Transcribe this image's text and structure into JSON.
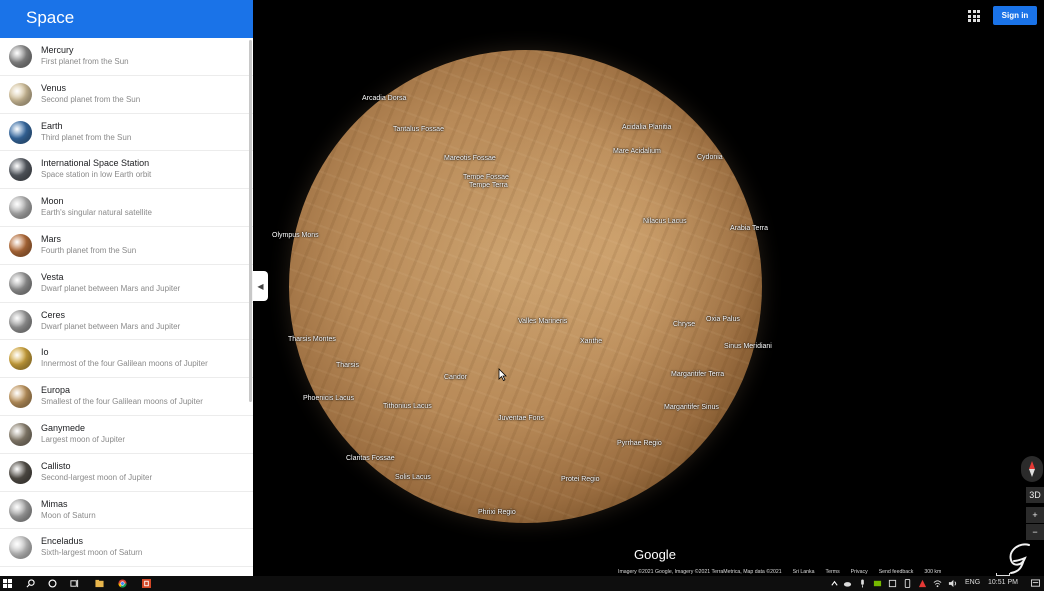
{
  "sidebar": {
    "title": "Space",
    "items": [
      {
        "name": "Mercury",
        "desc": "First planet from the Sun",
        "color": "#8d8d8d"
      },
      {
        "name": "Venus",
        "desc": "Second planet from the Sun",
        "color": "#d9c7a1"
      },
      {
        "name": "Earth",
        "desc": "Third planet from the Sun",
        "color": "#3a6fa8"
      },
      {
        "name": "International Space Station",
        "desc": "Space station in low Earth orbit",
        "color": "#5a5f66"
      },
      {
        "name": "Moon",
        "desc": "Earth's singular natural satellite",
        "color": "#b5b5b5"
      },
      {
        "name": "Mars",
        "desc": "Fourth planet from the Sun",
        "color": "#b9703c"
      },
      {
        "name": "Vesta",
        "desc": "Dwarf planet between Mars and Jupiter",
        "color": "#9a9a9a"
      },
      {
        "name": "Ceres",
        "desc": "Dwarf planet between Mars and Jupiter",
        "color": "#9d9d9d"
      },
      {
        "name": "Io",
        "desc": "Innermost of the four Galilean moons of Jupiter",
        "color": "#d4a93f"
      },
      {
        "name": "Europa",
        "desc": "Smallest of the four Galilean moons of Jupiter",
        "color": "#c49a62"
      },
      {
        "name": "Ganymede",
        "desc": "Largest moon of Jupiter",
        "color": "#8f8574"
      },
      {
        "name": "Callisto",
        "desc": "Second-largest moon of Jupiter",
        "color": "#56524b"
      },
      {
        "name": "Mimas",
        "desc": "Moon of Saturn",
        "color": "#a8a8a8"
      },
      {
        "name": "Enceladus",
        "desc": "Sixth-largest moon of Saturn",
        "color": "#c9c9c9"
      }
    ]
  },
  "map": {
    "labels": [
      "Arcadia Dorsa",
      "Tantalus Fossae",
      "Acidalia Planitia",
      "Mareotis Fossae",
      "Mare Acidalium",
      "Cydonia",
      "Tempe Fossae",
      "Tempe Terra",
      "Nilacus Lacus",
      "Arabia Terra",
      "Olympus Mons",
      "Oxia Palus",
      "Valles Marineris",
      "Chryse",
      "Sinus Meridiani",
      "Tharsis Montes",
      "Xanthe",
      "Tharsis",
      "Candor",
      "Margaritifer Terra",
      "Phoenicis Lacus",
      "Tithonius Lacus",
      "Margaritifer Sinus",
      "Juventae Fons",
      "Pyrrhae Regio",
      "Claritas Fossae",
      "Solis Lacus",
      "Protei Regio",
      "Phrixi Regio"
    ],
    "sign_in": "Sign in",
    "three_d": "3D",
    "zoom_in": "+",
    "zoom_out": "−",
    "logo": "Google",
    "attribution": {
      "imagery": "Imagery ©2021 Google, Imagery ©2021 TerraMetrica, Map data ©2021",
      "region": "Sri Lanka",
      "terms": "Terms",
      "privacy": "Privacy",
      "feedback": "Send feedback",
      "scale": "300 km"
    }
  },
  "taskbar": {
    "language": "ENG",
    "time": "10:51 PM"
  },
  "colors": {
    "accent": "#1a73e8",
    "background": "#000000",
    "planet": "#b88a58"
  }
}
